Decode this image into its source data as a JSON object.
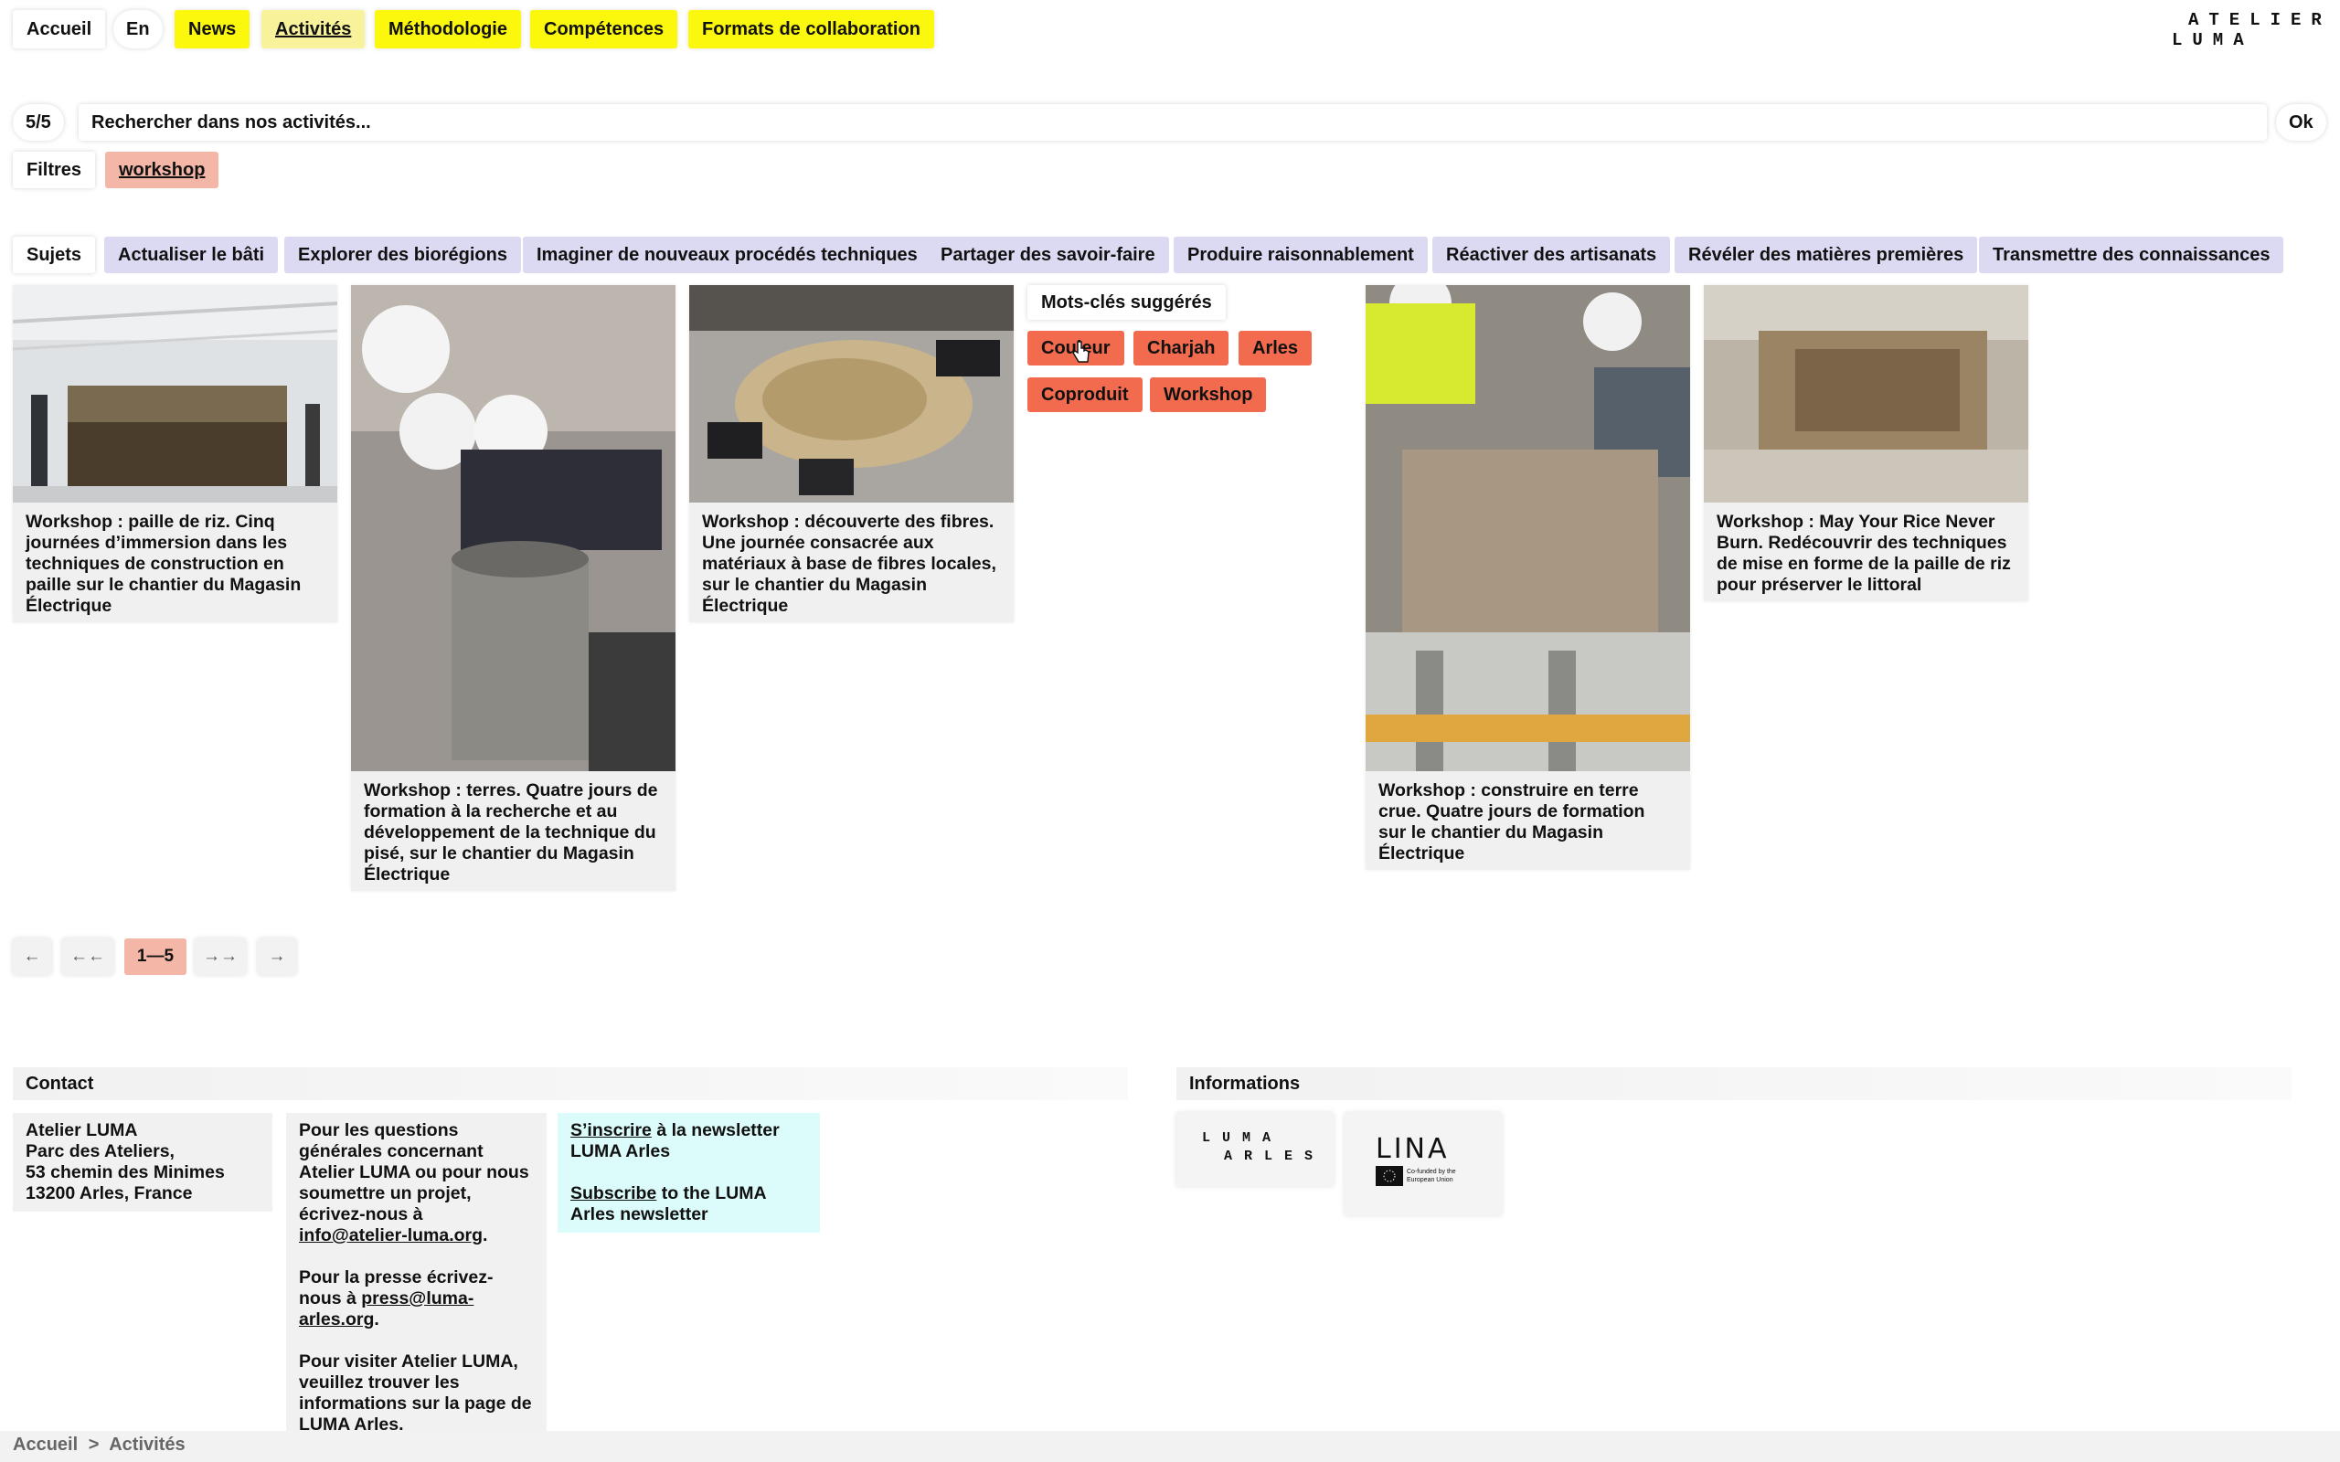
{
  "nav": {
    "items": [
      {
        "label": "Accueil"
      },
      {
        "label": "En"
      },
      {
        "label": "News"
      },
      {
        "label": "Activités"
      },
      {
        "label": "Méthodologie"
      },
      {
        "label": "Compétences"
      },
      {
        "label": "Formats de collaboration"
      }
    ]
  },
  "logo": {
    "line1": "ATELIER",
    "line2": "LUMA"
  },
  "search": {
    "count": "5/5",
    "placeholder": "Rechercher dans nos activités...",
    "ok_label": "Ok"
  },
  "filters": {
    "label": "Filtres",
    "active_tag": "workshop"
  },
  "subjects": {
    "label": "Sujets",
    "items": [
      "Actualiser le bâti",
      "Explorer des biorégions",
      "Imaginer de nouveaux procédés techniques",
      "Partager des savoir-faire",
      "Produire raisonnablement",
      "Réactiver des artisanats",
      "Révéler des matières premières",
      "Transmettre des connaissances"
    ]
  },
  "cards": [
    {
      "caption": "Workshop : paille de riz. Cinq journées d’immersion dans les techniques de construction en paille sur le chantier du Magasin Électrique"
    },
    {
      "caption": "Workshop : terres. Quatre jours de formation à la recherche et au développement de la technique du pisé, sur le chantier du Magasin Électrique"
    },
    {
      "caption": "Workshop : découverte des fibres. Une journée consacrée aux matériaux à base de fibres locales, sur le chantier du Magasin Électrique"
    },
    {
      "caption": "Workshop : construire en terre crue. Quatre jours de formation sur le chantier du Magasin Électrique"
    },
    {
      "caption": "Workshop : May Your Rice Never Burn. Redécouvrir des techniques de mise en forme de la paille de riz pour préserver le littoral"
    }
  ],
  "keywords": {
    "title": "Mots-clés suggérés",
    "items": [
      "Couleur",
      "Charjah",
      "Arles",
      "Coproduit",
      "Workshop"
    ]
  },
  "pagination": {
    "prev": "←",
    "first": "←←",
    "current": "1—5",
    "last": "→→",
    "next": "→"
  },
  "footer": {
    "contact_title": "Contact",
    "info_title": "Informations",
    "address": [
      "Atelier LUMA",
      "Parc des Ateliers,",
      "53 chemin des Minimes",
      "13200 Arles, France"
    ],
    "questions_text": "Pour les questions générales concernant Atelier LUMA ou pour nous soumettre un projet, écrivez-nous à",
    "questions_email": "info@atelier-luma.org",
    "press_text": "Pour la presse écrivez-nous à",
    "press_email": "press@luma-arles.org",
    "visit_text": "Pour visiter Atelier LUMA, veuillez trouver les informations sur la page de",
    "visit_link": "LUMA Arles",
    "newsletter_fr_link": "S’inscrire",
    "newsletter_fr_text": "à la newsletter LUMA Arles",
    "newsletter_en_link": "Subscribe",
    "newsletter_en_text": "to the LUMA Arles newsletter",
    "luma_arles_logo": {
      "line1": "LUMA",
      "line2": "ARLES"
    },
    "lina_logo": {
      "mark": "LINA",
      "eu_text": "Co-funded by the European Union"
    }
  },
  "breadcrumb": {
    "home": "Accueil",
    "separator": ">",
    "current": "Activités"
  },
  "colors": {
    "nav_yellow": "#fbf70d",
    "tag_pink": "#f4b6a7",
    "keyword_orange": "#f26b4e",
    "subject_lavender": "#dcd9f3",
    "newsletter_cyan": "#dcfbfb"
  }
}
